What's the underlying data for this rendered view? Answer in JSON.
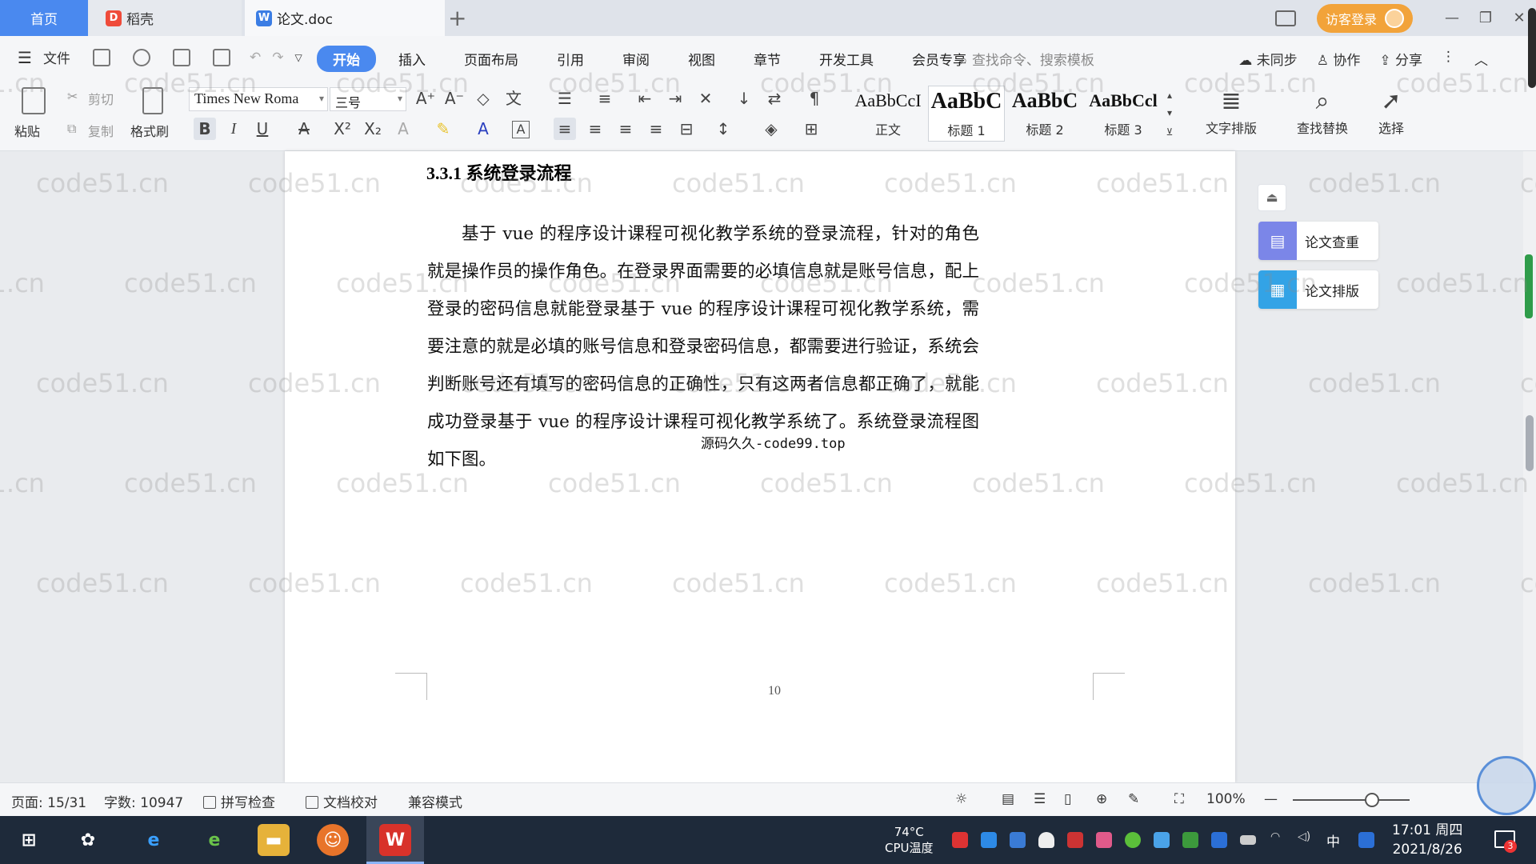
{
  "tabs": {
    "home": "首页",
    "daoke": "稻壳",
    "doc": "论文.doc",
    "add": "+"
  },
  "window": {
    "login": "访客登录",
    "minimize": "—",
    "restore": "❐",
    "close": "✕"
  },
  "menu": {
    "file": "文件",
    "tabs": [
      "开始",
      "插入",
      "页面布局",
      "引用",
      "审阅",
      "视图",
      "章节",
      "开发工具",
      "会员专享"
    ],
    "search_placeholder": "查找命令、搜索模板",
    "sync": "未同步",
    "collab": "协作",
    "share": "分享"
  },
  "ribbon": {
    "paste": "粘贴",
    "cut": "剪切",
    "copy": "复制",
    "format_painter": "格式刷",
    "font_name": "Times New Roma",
    "font_size": "三号",
    "styles": [
      {
        "preview": "AaBbCcI",
        "label": "正文"
      },
      {
        "preview": "AaBbC",
        "label": "标题 1"
      },
      {
        "preview": "AaBbC",
        "label": "标题 2"
      },
      {
        "preview": "AaBbCcl",
        "label": "标题 3"
      }
    ],
    "text_layout": "文字排版",
    "find_replace": "查找替换",
    "select": "选择"
  },
  "document": {
    "heading": "3.3.1 系统登录流程",
    "paragraph": "基于 vue 的程序设计课程可视化教学系统的登录流程，针对的角色就是操作员的操作角色。在登录界面需要的必填信息就是账号信息，配上登录的密码信息就能登录基于 vue 的程序设计课程可视化教学系统，需要注意的就是必填的账号信息和登录密码信息，都需要进行验证，系统会判断账号还有填写的密码信息的正确性，只有这两者信息都正确了，就能成功登录基于 vue 的程序设计课程可视化教学系统了。系统登录流程图如下图。",
    "source_note": "源码久久-code99.top",
    "page_number": "10"
  },
  "side_panel": {
    "check": "论文查重",
    "layout": "论文排版"
  },
  "status": {
    "page": "页面: 15/31",
    "words": "字数: 10947",
    "spell": "拼写检查",
    "proof": "文档校对",
    "compat": "兼容模式",
    "zoom": "100%"
  },
  "taskbar": {
    "cpu_temp": "74°C",
    "cpu_label": "CPU温度",
    "ime": "中",
    "time": "17:01 周四",
    "date": "2021/8/26",
    "notif_count": "3"
  },
  "watermark": "code51.cn",
  "colors": {
    "accent": "#4a89ef",
    "login": "#f2a33a",
    "taskbar": "#1e2a3a"
  }
}
